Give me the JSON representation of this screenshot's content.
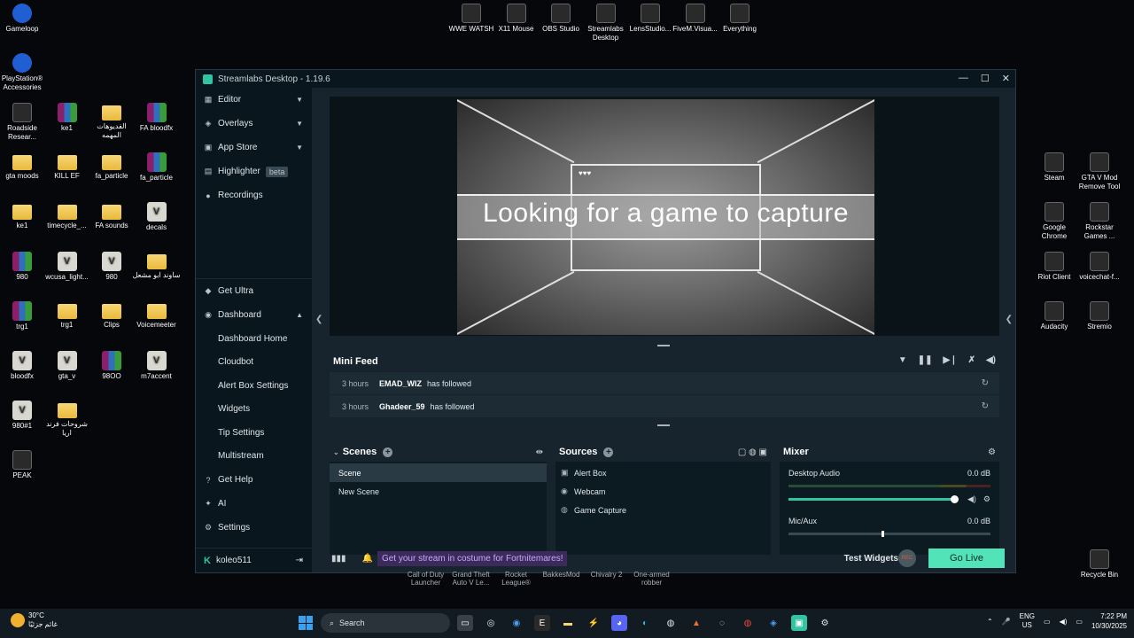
{
  "desktop": {
    "left_icons": [
      {
        "label": "Gameloop",
        "kind": "blue"
      },
      {
        "label": "PlayStation® Accessories",
        "kind": "blue"
      },
      {
        "label": "Roadside Resear...",
        "kind": "app"
      },
      {
        "label": "ke1",
        "kind": "zip"
      },
      {
        "label": "الفديوهات المهمه",
        "kind": "folder"
      },
      {
        "label": "FA bloodfx",
        "kind": "zip"
      },
      {
        "label": "gta moods",
        "kind": "folder"
      },
      {
        "label": "KILL EF",
        "kind": "folder"
      },
      {
        "label": "fa_particle",
        "kind": "folder"
      },
      {
        "label": "fa_particle",
        "kind": "zip"
      },
      {
        "label": "ke1",
        "kind": "folder"
      },
      {
        "label": "timecycle_...",
        "kind": "folder"
      },
      {
        "label": "FA sounds",
        "kind": "folder"
      },
      {
        "label": "decals",
        "kind": "v"
      },
      {
        "label": "980",
        "kind": "zip"
      },
      {
        "label": "wcusa_light...",
        "kind": "v"
      },
      {
        "label": "980",
        "kind": "v"
      },
      {
        "label": "ساوند ابو مشعل",
        "kind": "folder"
      },
      {
        "label": "trg1",
        "kind": "zip"
      },
      {
        "label": "trg1",
        "kind": "folder"
      },
      {
        "label": "Clips",
        "kind": "folder"
      },
      {
        "label": "Voicemeeter",
        "kind": "folder"
      },
      {
        "label": "bloodfx",
        "kind": "v"
      },
      {
        "label": "gta_v",
        "kind": "v"
      },
      {
        "label": "98OO",
        "kind": "zip"
      },
      {
        "label": "m7accent",
        "kind": "v"
      },
      {
        "label": "980#1",
        "kind": "v"
      },
      {
        "label": "شروحات فرند اريا",
        "kind": "folder"
      },
      {
        "label": "PEAK",
        "kind": "app"
      }
    ],
    "top_icons": [
      {
        "label": "WWE WATSH"
      },
      {
        "label": "X11 Mouse"
      },
      {
        "label": "OBS Studio"
      },
      {
        "label": "Streamlabs Desktop"
      },
      {
        "label": "LensStudio..."
      },
      {
        "label": "FiveM.Visua..."
      },
      {
        "label": "Everything"
      }
    ],
    "right_icons": [
      {
        "label": "Steam"
      },
      {
        "label": "GTA V Mod Remove Tool"
      },
      {
        "label": "Google Chrome"
      },
      {
        "label": "Rockstar Games ..."
      },
      {
        "label": "Riot Client"
      },
      {
        "label": "voicechat-f..."
      },
      {
        "label": "Audacity"
      },
      {
        "label": "Stremio"
      },
      {
        "label": "Recycle Bin"
      }
    ],
    "bottom_labels": [
      "Call of Duty Launcher",
      "Grand Theft Auto V Le...",
      "Rocket League®",
      "BakkesMod",
      "Chivalry 2",
      "One-armed robber"
    ]
  },
  "window": {
    "title": "Streamlabs Desktop - 1.19.6",
    "controls": {
      "minimize": "—",
      "maximize": "☐",
      "close": "✕"
    }
  },
  "sidebar": {
    "top_items": [
      {
        "label": "Editor",
        "icon": "editor-icon",
        "has_chevron": true
      },
      {
        "label": "Overlays",
        "icon": "overlays-icon",
        "has_chevron": true
      },
      {
        "label": "App Store",
        "icon": "app-store-icon",
        "has_chevron": true
      },
      {
        "label": "Highlighter",
        "icon": "highlighter-icon",
        "badge": "beta"
      },
      {
        "label": "Recordings",
        "icon": "recordings-icon"
      }
    ],
    "get_ultra": "Get Ultra",
    "dashboard": "Dashboard",
    "dashboard_items": [
      "Dashboard Home",
      "Cloudbot",
      "Alert Box Settings",
      "Widgets",
      "Tip Settings",
      "Multistream"
    ],
    "get_help": "Get Help",
    "ai": "AI",
    "settings": "Settings",
    "username": "koleo511"
  },
  "preview": {
    "message": "Looking for a game to capture"
  },
  "mini_feed": {
    "title": "Mini Feed",
    "rows": [
      {
        "time": "3 hours",
        "name": "EMAD_WIZ",
        "action": "has followed"
      },
      {
        "time": "3 hours",
        "name": "Ghadeer_59",
        "action": "has followed"
      }
    ]
  },
  "scenes": {
    "title": "Scenes",
    "items": [
      {
        "label": "Scene",
        "active": true
      },
      {
        "label": "New Scene",
        "active": false
      }
    ]
  },
  "sources": {
    "title": "Sources",
    "items": [
      {
        "label": "Alert Box",
        "icon": "alert-box-icon"
      },
      {
        "label": "Webcam",
        "icon": "webcam-icon"
      },
      {
        "label": "Game Capture",
        "icon": "gamepad-icon"
      }
    ]
  },
  "mixer": {
    "title": "Mixer",
    "channels": [
      {
        "name": "Desktop Audio",
        "level": "0.0 dB",
        "volume_fraction": 1.0
      },
      {
        "name": "Mic/Aux",
        "level": "0.0 dB",
        "volume_fraction": 0.46
      }
    ]
  },
  "footer": {
    "promo": "Get your stream in costume for Fortnitemares!",
    "test_widgets": "Test Widgets",
    "rec_label": "REC",
    "go_live": "Go Live"
  },
  "taskbar": {
    "weather_temp": "30°C",
    "weather_desc": "غائم جزئيًا",
    "search_placeholder": "Search",
    "lang_top": "ENG",
    "lang_bottom": "US",
    "time": "7:22 PM",
    "date": "10/30/2025"
  },
  "colors": {
    "accent": "#31c3a2",
    "go_live": "#52e3b8",
    "window_bg": "#17242d",
    "sidebar_bg": "#09161d",
    "promo_bg": "#3b2a5a"
  }
}
